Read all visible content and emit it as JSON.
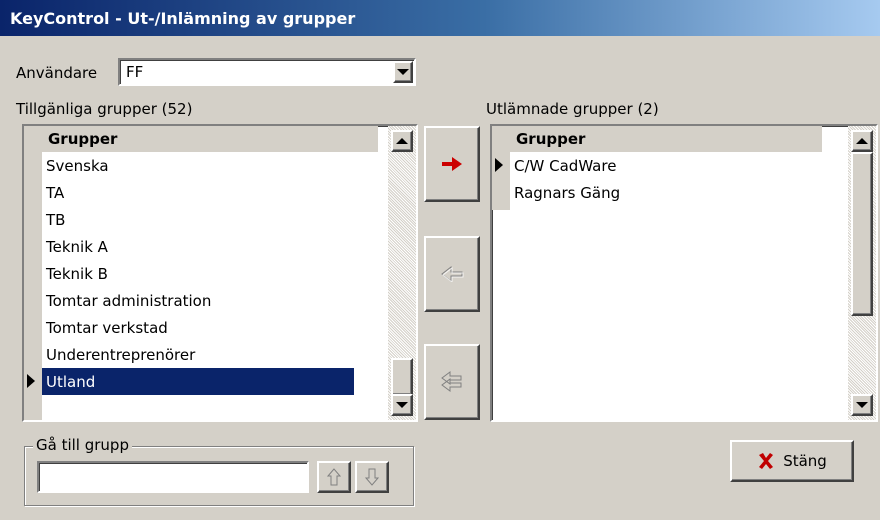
{
  "window": {
    "title": "KeyControl - Ut-/Inlämning av grupper"
  },
  "user": {
    "label": "Användare",
    "value": "FF"
  },
  "available": {
    "label": "Tillgänliga grupper (52)",
    "header": "Grupper",
    "rows": [
      "Svenska",
      "TA",
      "TB",
      "Teknik A",
      "Teknik B",
      "Tomtar administration",
      "Tomtar verkstad",
      "Underentreprenörer",
      "Utland"
    ],
    "selected_index": 8
  },
  "lent": {
    "label": "Utlämnade grupper (2)",
    "header": "Grupper",
    "rows": [
      "C/W CadWare",
      "Ragnars Gäng"
    ],
    "current_index": 0
  },
  "goto": {
    "legend": "Gå till grupp",
    "value": ""
  },
  "close_button": {
    "label": "Stäng"
  },
  "colors": {
    "selection": "#0a246a",
    "arrow_red": "#cc0000",
    "close_x": "#c00000"
  }
}
